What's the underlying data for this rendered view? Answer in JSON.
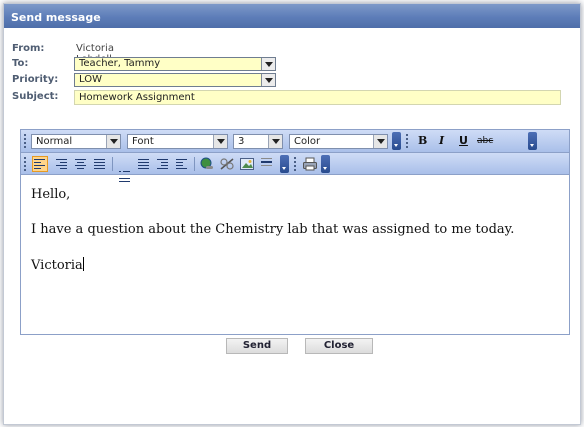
{
  "dialog": {
    "title": "Send message"
  },
  "form": {
    "from_label": "From:",
    "from_value": "Victoria Lobdell",
    "to_label": "To:",
    "to_value": "Teacher, Tammy",
    "priority_label": "Priority:",
    "priority_value": "LOW",
    "subject_label": "Subject:",
    "subject_value": "Homework Assignment"
  },
  "toolbar": {
    "style_value": "Normal",
    "font_value": "Font",
    "size_value": "3",
    "color_value": "Color",
    "bold": "B",
    "italic": "I",
    "underline": "U",
    "strike": "abc"
  },
  "message": {
    "line1": "Hello,",
    "line2": "I have a question about the Chemistry lab that was assigned to me today.",
    "line3": "Victoria"
  },
  "buttons": {
    "send": "Send",
    "close": "Close"
  },
  "colors": {
    "title_bar": "#5d7db8",
    "field_bg": "#ffffc6",
    "toolbar_bg": "#b9cdf0",
    "active_button": "#ffd58a"
  },
  "icons": [
    "align-left-icon",
    "align-right-icon",
    "align-center-icon",
    "justify-icon",
    "ordered-list-icon",
    "unordered-list-icon",
    "outdent-icon",
    "indent-icon",
    "insert-link-icon",
    "remove-link-icon",
    "insert-image-icon",
    "horizontal-rule-icon",
    "print-icon"
  ]
}
